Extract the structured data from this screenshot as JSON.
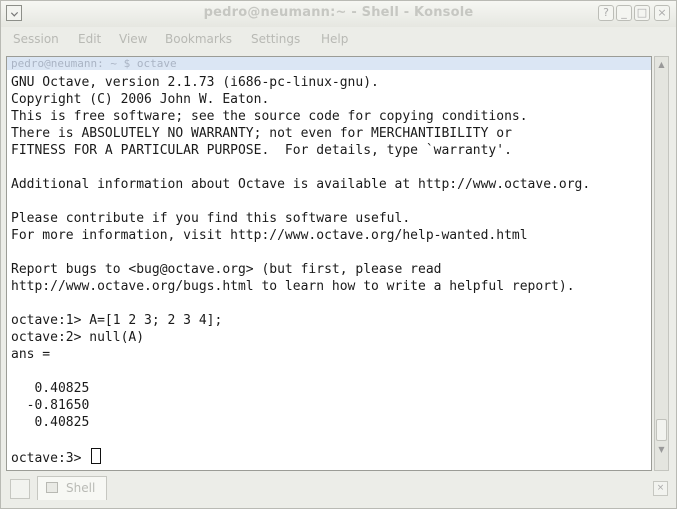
{
  "window": {
    "title": "pedro@neumann:~ - Shell - Konsole"
  },
  "menu": {
    "items": [
      "Session",
      "Edit",
      "View",
      "Bookmarks",
      "Settings",
      "Help"
    ]
  },
  "session": {
    "strip_text": "pedro@neumann: ~ $ octave"
  },
  "terminal": {
    "lines": [
      "GNU Octave, version 2.1.73 (i686-pc-linux-gnu).",
      "Copyright (C) 2006 John W. Eaton.",
      "This is free software; see the source code for copying conditions.",
      "There is ABSOLUTELY NO WARRANTY; not even for MERCHANTIBILITY or",
      "FITNESS FOR A PARTICULAR PURPOSE.  For details, type `warranty'.",
      "",
      "Additional information about Octave is available at http://www.octave.org.",
      "",
      "Please contribute if you find this software useful.",
      "For more information, visit http://www.octave.org/help-wanted.html",
      "",
      "Report bugs to <bug@octave.org> (but first, please read",
      "http://www.octave.org/bugs.html to learn how to write a helpful report).",
      "",
      "octave:1> A=[1 2 3; 2 3 4];",
      "octave:2> null(A)",
      "ans =",
      "",
      "   0.40825",
      "  -0.81650",
      "   0.40825",
      "",
      "octave:3> "
    ]
  },
  "tabs": {
    "items": [
      {
        "label": "Shell"
      }
    ]
  },
  "icons": {
    "window_menu": "konsole-icon",
    "help": "help-icon",
    "minimize": "minimize-icon",
    "maximize": "maximize-icon",
    "close": "close-icon",
    "new_tab": "new-tab-icon",
    "close_tab": "close-tab-icon"
  },
  "colors": {
    "terminal_bg": "#ffffff",
    "terminal_fg": "#1a1a1a",
    "chrome_bg": "#ecede8"
  }
}
